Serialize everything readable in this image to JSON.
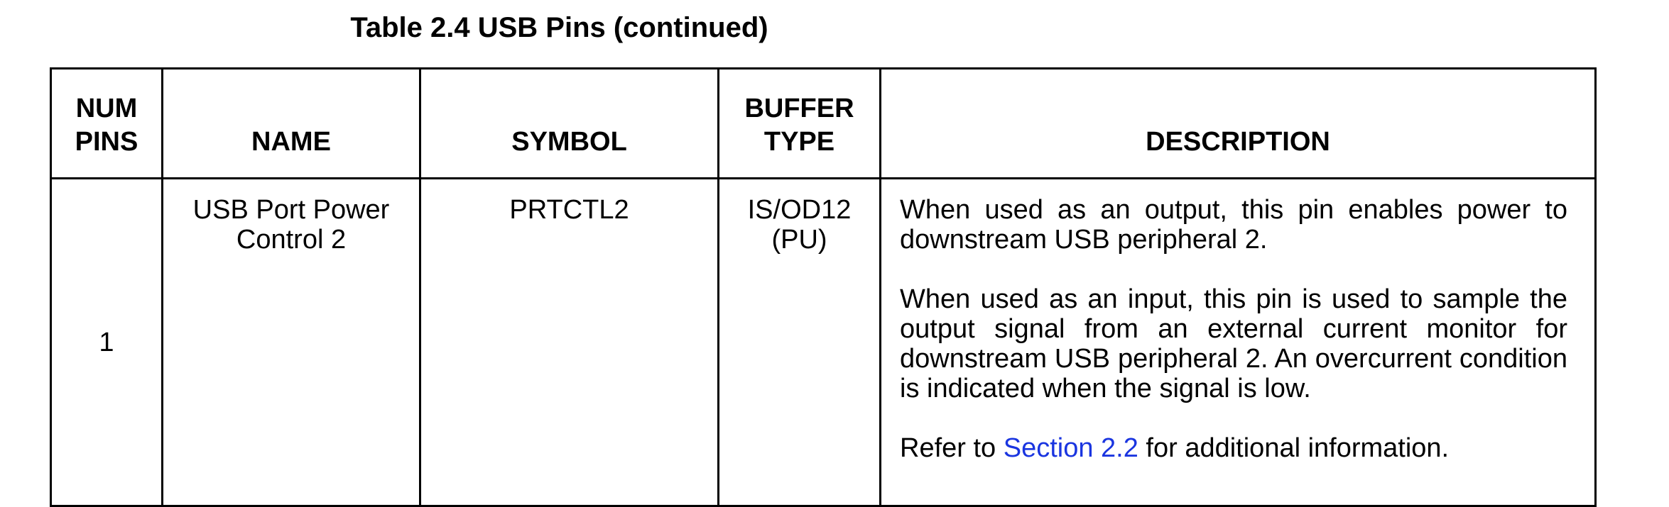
{
  "caption": "Table 2.4 USB Pins (continued)",
  "headers": {
    "num_pins_line1": "NUM",
    "num_pins_line2": "PINS",
    "name": "NAME",
    "symbol": "SYMBOL",
    "buffer_line1": "BUFFER",
    "buffer_line2": "TYPE",
    "description": "DESCRIPTION"
  },
  "row": {
    "num_pins": "1",
    "name_line1": "USB Port Power",
    "name_line2": "Control 2",
    "symbol": "PRTCTL2",
    "buffer_line1": "IS/OD12",
    "buffer_line2": "(PU)",
    "description_p1": "When used as an output, this pin enables power to downstream USB peripheral 2.",
    "description_p2": "When used as an input, this pin is used to sample the output signal from an external current monitor for downstream USB peripheral 2. An overcurrent condition is indicated when the signal is low.",
    "description_p3_prefix": "Refer to ",
    "description_p3_link": "Section 2.2",
    "description_p3_suffix": " for additional information."
  },
  "colors": {
    "link": "#1a35e0",
    "border": "#000000"
  }
}
